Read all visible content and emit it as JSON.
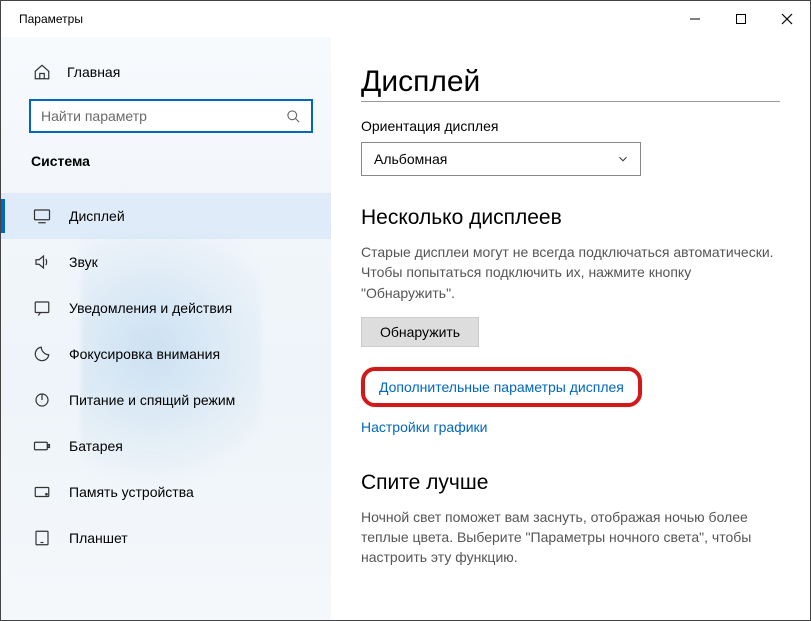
{
  "window": {
    "title": "Параметры"
  },
  "sidebar": {
    "home_label": "Главная",
    "search_placeholder": "Найти параметр",
    "category_label": "Система",
    "items": [
      {
        "label": "Дисплей"
      },
      {
        "label": "Звук"
      },
      {
        "label": "Уведомления и действия"
      },
      {
        "label": "Фокусировка внимания"
      },
      {
        "label": "Питание и спящий режим"
      },
      {
        "label": "Батарея"
      },
      {
        "label": "Память устройства"
      },
      {
        "label": "Планшет"
      }
    ]
  },
  "main": {
    "title": "Дисплей",
    "orientation_label": "Ориентация дисплея",
    "orientation_value": "Альбомная",
    "multi_title": "Несколько дисплеев",
    "multi_text": "Старые дисплеи могут не всегда подключаться автоматически. Чтобы попытаться подключить их, нажмите кнопку \"Обнаружить\".",
    "detect_button": "Обнаружить",
    "advanced_link": "Дополнительные параметры дисплея",
    "graphics_link": "Настройки графики",
    "sleep_title": "Спите лучше",
    "sleep_text": "Ночной свет поможет вам заснуть, отображая ночью более теплые цвета. Выберите \"Параметры ночного света\", чтобы настроить эту функцию."
  }
}
